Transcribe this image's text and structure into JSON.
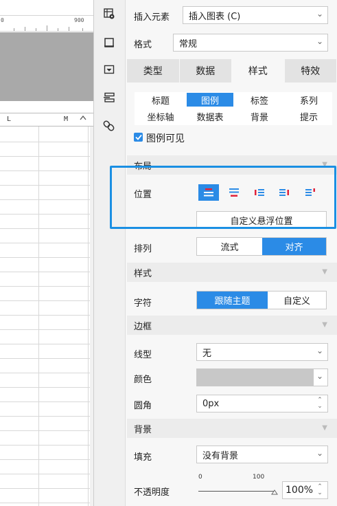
{
  "sheet": {
    "ruler_left_number": "0",
    "ruler_right_number": "900",
    "columns": [
      "L",
      "M"
    ],
    "scroll_up_glyph": "^"
  },
  "rail": {
    "icons": [
      "chart-settings-icon",
      "frame-icon",
      "widget-icon",
      "layer-icon",
      "link-icon"
    ]
  },
  "panel": {
    "insert_label": "插入元素",
    "insert_value": "插入图表 (C)",
    "format_label": "格式",
    "format_value": "常规",
    "tabs": [
      "类型",
      "数据",
      "样式",
      "特效"
    ],
    "active_tab": "样式",
    "subtabs": [
      "标题",
      "图例",
      "标签",
      "系列",
      "坐标轴",
      "数据表",
      "背景",
      "提示"
    ],
    "active_subtab": "图例",
    "legend_visible_label": "图例可见",
    "legend_visible_checked": true,
    "layout_section": "布局",
    "position_label": "位置",
    "custom_float_button": "自定义悬浮位置",
    "arrange_label": "排列",
    "arrange_options": [
      "流式",
      "对齐"
    ],
    "arrange_active": "对齐",
    "style_section": "样式",
    "font_label": "字符",
    "font_options": [
      "跟随主题",
      "自定义"
    ],
    "font_active": "跟随主题",
    "border_section": "边框",
    "line_label": "线型",
    "line_value": "无",
    "color_label": "颜色",
    "radius_label": "圆角",
    "radius_value": "0px",
    "background_section": "背景",
    "fill_label": "填充",
    "fill_value": "没有背景",
    "opacity_label": "不透明度",
    "opacity_min": "0",
    "opacity_max": "100",
    "opacity_value": "100%"
  },
  "colors": {
    "accent": "#2b8be6",
    "highlight_border": "#1a8fe3",
    "position_marker": "#e0223a",
    "gray_canvas": "#a9a9a9"
  }
}
